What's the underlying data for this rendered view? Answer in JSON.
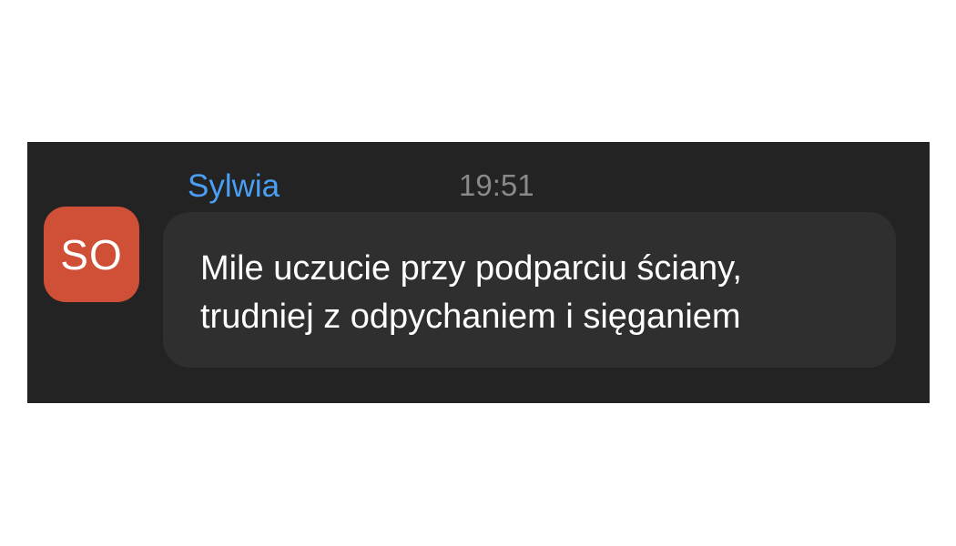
{
  "message": {
    "avatar_initials": "SO",
    "sender": "Sylwia",
    "time": "19:51",
    "text_lines": [
      "Mile uczucie przy podparciu ściany,",
      "trudniej z odpychaniem i sięganiem"
    ]
  },
  "colors": {
    "panel_background": "#232323",
    "bubble_background": "#2f2f2f",
    "avatar_background": "#cf4f37",
    "sender_name": "#4a9ff5",
    "timestamp": "#8a8a8a",
    "message_text": "#ffffff"
  }
}
